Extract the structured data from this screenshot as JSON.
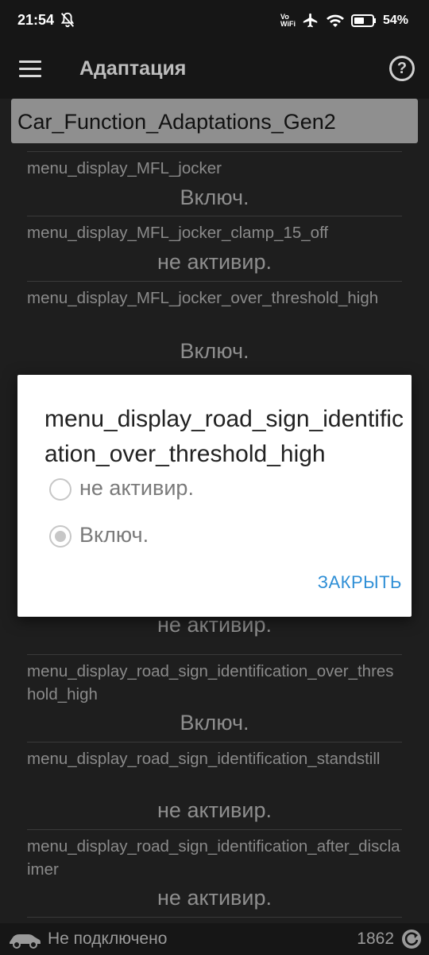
{
  "status_bar": {
    "time": "21:54",
    "vowifi": [
      "Vo",
      "WiFi"
    ],
    "battery": "54%"
  },
  "app_bar": {
    "title": "Адаптация",
    "help_symbol": "?"
  },
  "module_header": "Car_Function_Adaptations_Gen2",
  "items_top": [
    {
      "name": "menu_display_MFL_jocker",
      "value": "Включ."
    },
    {
      "name": "menu_display_MFL_jocker_clamp_15_off",
      "value": "не активир."
    },
    {
      "name": "menu_display_MFL_jocker_over_threshold_high",
      "value": "Включ."
    }
  ],
  "partial_value": "не активир.",
  "items_bottom": [
    {
      "name": "menu_display_road_sign_identification_over_threshold_high",
      "value": "Включ."
    },
    {
      "name": "menu_display_road_sign_identification_standstill",
      "value": "не активир."
    },
    {
      "name": "menu_display_road_sign_identification_after_disclaimer",
      "value": "не активир."
    }
  ],
  "dialog": {
    "title": "menu_display_road_sign_identification_over_threshold_high",
    "options": [
      {
        "label": "не активир.",
        "checked": false
      },
      {
        "label": "Включ.",
        "checked": true
      }
    ],
    "close_label": "ЗАКРЫТЬ"
  },
  "bottom_bar": {
    "connection_status": "Не подключено",
    "counter": "1862"
  },
  "icons": {
    "menu": "hamburger-icon",
    "help": "help-icon",
    "car": "car-icon",
    "refresh": "refresh-icon"
  },
  "colors": {
    "accent": "#2f8fd6",
    "header_bg": "#8f8f8f"
  }
}
